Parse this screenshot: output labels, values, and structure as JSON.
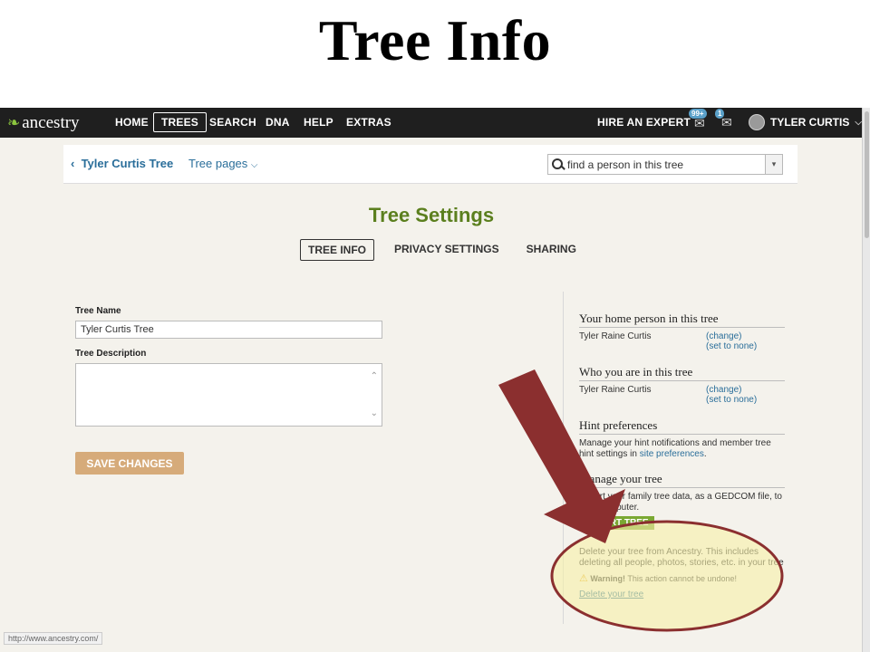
{
  "slide": {
    "title": "Tree Info"
  },
  "topnav": {
    "logo": "ancestry",
    "items": [
      "HOME",
      "TREES",
      "SEARCH",
      "DNA",
      "HELP",
      "EXTRAS"
    ],
    "hire_expert": "HIRE AN EXPERT",
    "notif_count": "99+",
    "msg_count": "1",
    "user": "TYLER CURTIS"
  },
  "subheader": {
    "back_label": "Tyler Curtis Tree",
    "tree_pages": "Tree pages",
    "search_placeholder": "find a person in this tree"
  },
  "page": {
    "title": "Tree Settings",
    "tabs": [
      "TREE INFO",
      "PRIVACY SETTINGS",
      "SHARING"
    ]
  },
  "form": {
    "tree_name_label": "Tree Name",
    "tree_name_value": "Tyler Curtis Tree",
    "tree_desc_label": "Tree Description",
    "tree_desc_value": "",
    "save_label": "SAVE CHANGES"
  },
  "sidebar": {
    "home_person": {
      "heading": "Your home person in this tree",
      "name": "Tyler Raine Curtis",
      "change": "(change)",
      "set_none": "(set to none)"
    },
    "who_you_are": {
      "heading": "Who you are in this tree",
      "name": "Tyler Raine Curtis",
      "change": "(change)",
      "set_none": "(set to none)"
    },
    "hints": {
      "heading": "Hint preferences",
      "text": "Manage your hint notifications and member tree hint settings in",
      "link": "site preferences",
      "end": "."
    },
    "manage": {
      "heading": "Manage your tree",
      "text": "Export your family tree data, as a GEDCOM file, to your computer.",
      "export_label": "EXPORT TREE"
    },
    "delete": {
      "text": "Delete your tree from Ancestry. This includes deleting all people, photos, stories, etc. in your tree",
      "warning_bold": "Warning!",
      "warning_text": "This action cannot be undone!",
      "link": "Delete your tree"
    }
  },
  "status_url": "http://www.ancestry.com/",
  "annotation": {
    "arrow_color": "#8b2f2f",
    "highlight_fill": "#f7f0a8",
    "highlight_stroke": "#8b2f2f"
  }
}
